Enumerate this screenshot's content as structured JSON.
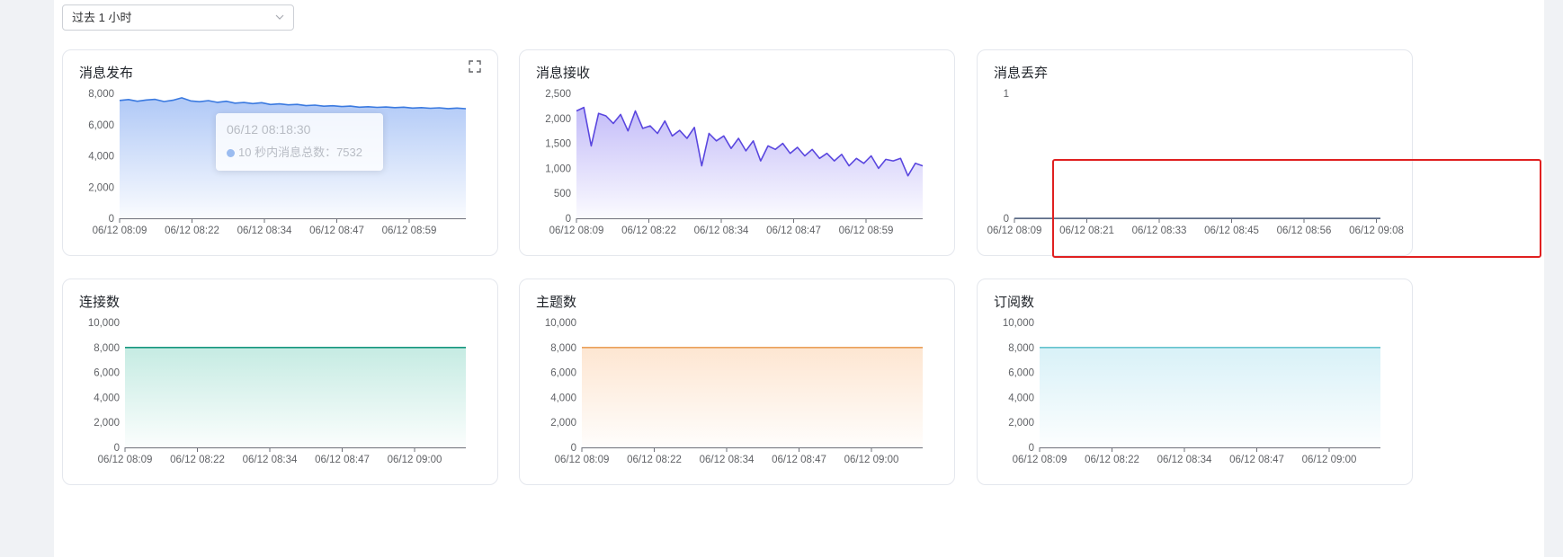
{
  "filter": {
    "time_range": "过去 1 小时"
  },
  "tooltip": {
    "time": "06/12 08:18:30",
    "label": "10 秒内消息总数：7532"
  },
  "chart_data": [
    {
      "id": "publish",
      "type": "area",
      "title": "消息发布",
      "color": "#3b7ae0",
      "fill": "#4f86ec",
      "x_labels": [
        "06/12 08:09",
        "06/12 08:22",
        "06/12 08:34",
        "06/12 08:47",
        "06/12 08:59"
      ],
      "y_ticks": [
        "8,000",
        "6,000",
        "4,000",
        "2,000",
        "0"
      ],
      "ylim": [
        0,
        8000
      ],
      "series": [
        {
          "values": [
            7550,
            7610,
            7500,
            7580,
            7620,
            7480,
            7560,
            7720,
            7520,
            7470,
            7540,
            7430,
            7500,
            7380,
            7420,
            7350,
            7410,
            7290,
            7330,
            7270,
            7300,
            7220,
            7250,
            7180,
            7210,
            7160,
            7190,
            7120,
            7150,
            7110,
            7130,
            7090,
            7120,
            7060,
            7090,
            7050,
            7080,
            7030,
            7060,
            7020
          ]
        }
      ]
    },
    {
      "id": "receive",
      "type": "area",
      "title": "消息接收",
      "color": "#5a47df",
      "fill": "#7a6af0",
      "x_labels": [
        "06/12 08:09",
        "06/12 08:22",
        "06/12 08:34",
        "06/12 08:47",
        "06/12 08:59"
      ],
      "y_ticks": [
        "2,500",
        "2,000",
        "1,500",
        "1,000",
        "500",
        "0"
      ],
      "ylim": [
        0,
        2500
      ],
      "series": [
        {
          "values": [
            2150,
            2220,
            1450,
            2100,
            2050,
            1900,
            2080,
            1750,
            2150,
            1800,
            1850,
            1700,
            1950,
            1650,
            1760,
            1600,
            1820,
            1050,
            1700,
            1550,
            1650,
            1400,
            1600,
            1350,
            1550,
            1150,
            1450,
            1380,
            1500,
            1300,
            1420,
            1250,
            1380,
            1200,
            1300,
            1150,
            1280,
            1050,
            1200,
            1100,
            1250,
            1000,
            1180,
            1150,
            1200,
            850,
            1100,
            1050
          ]
        }
      ]
    },
    {
      "id": "dropped",
      "type": "line",
      "title": "消息丢弃",
      "color": "#5a6b8a",
      "fill": "",
      "x_labels": [
        "06/12 08:09",
        "06/12 08:21",
        "06/12 08:33",
        "06/12 08:45",
        "06/12 08:56",
        "06/12 09:08"
      ],
      "y_ticks": [
        "1",
        "0"
      ],
      "ylim": [
        0,
        1
      ],
      "series": [
        {
          "values": [
            0,
            0,
            0,
            0,
            0,
            0,
            0,
            0,
            0,
            0,
            0,
            0
          ]
        }
      ]
    },
    {
      "id": "connections",
      "type": "area",
      "title": "连接数",
      "color": "#15967e",
      "fill": "#7fd3c0",
      "x_labels": [
        "06/12 08:09",
        "06/12 08:22",
        "06/12 08:34",
        "06/12 08:47",
        "06/12 09:00"
      ],
      "y_ticks": [
        "10,000",
        "8,000",
        "6,000",
        "4,000",
        "2,000",
        "0"
      ],
      "ylim": [
        0,
        10000
      ],
      "series": [
        {
          "values": [
            8000,
            8000,
            8000,
            8000,
            8000,
            8000,
            8000,
            8000,
            8000,
            8000
          ]
        }
      ]
    },
    {
      "id": "topics",
      "type": "area",
      "title": "主题数",
      "color": "#eaa15a",
      "fill": "#fbc79a",
      "x_labels": [
        "06/12 08:09",
        "06/12 08:22",
        "06/12 08:34",
        "06/12 08:47",
        "06/12 09:00"
      ],
      "y_ticks": [
        "10,000",
        "8,000",
        "6,000",
        "4,000",
        "2,000",
        "0"
      ],
      "ylim": [
        0,
        10000
      ],
      "series": [
        {
          "values": [
            8000,
            8000,
            8000,
            8000,
            8000,
            8000,
            8000,
            8000,
            8000,
            8000
          ]
        }
      ]
    },
    {
      "id": "subscriptions",
      "type": "area",
      "title": "订阅数",
      "color": "#64c3cd",
      "fill": "#a9e0ee",
      "x_labels": [
        "06/12 08:09",
        "06/12 08:22",
        "06/12 08:34",
        "06/12 08:47",
        "06/12 09:00"
      ],
      "y_ticks": [
        "10,000",
        "8,000",
        "6,000",
        "4,000",
        "2,000",
        "0"
      ],
      "ylim": [
        0,
        10000
      ],
      "series": [
        {
          "values": [
            8000,
            8000,
            8000,
            8000,
            8000,
            8000,
            8000,
            8000,
            8000,
            8000
          ]
        }
      ]
    }
  ]
}
